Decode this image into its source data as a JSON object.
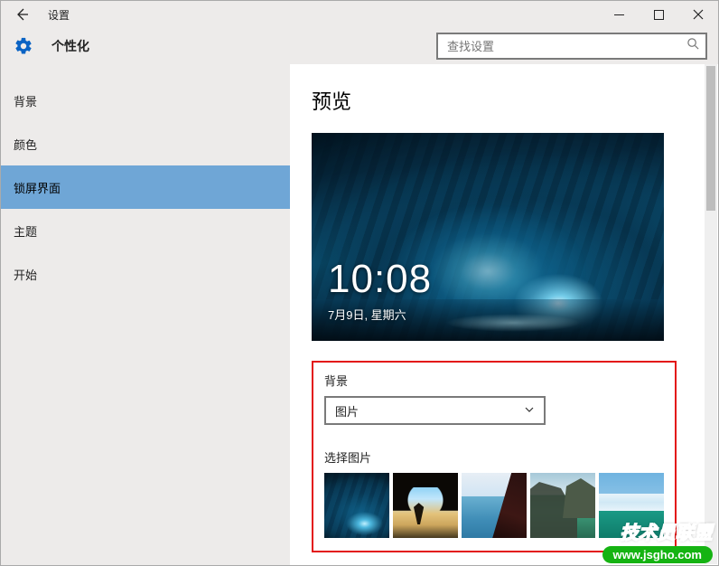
{
  "titlebar": {
    "title": "设置"
  },
  "header": {
    "section_title": "个性化"
  },
  "search": {
    "placeholder": "查找设置"
  },
  "sidebar": {
    "items": [
      {
        "label": "背景"
      },
      {
        "label": "颜色"
      },
      {
        "label": "锁屏界面"
      },
      {
        "label": "主题"
      },
      {
        "label": "开始"
      }
    ],
    "selected_index": 2
  },
  "content": {
    "preview_heading": "预览",
    "lockscreen": {
      "time": "10:08",
      "date": "7月9日, 星期六"
    },
    "background_label": "背景",
    "background_dropdown": {
      "value": "图片"
    },
    "choose_picture_label": "选择图片"
  },
  "watermark": {
    "line1": "技术员联盟",
    "line2": "www.jsgho.com"
  }
}
